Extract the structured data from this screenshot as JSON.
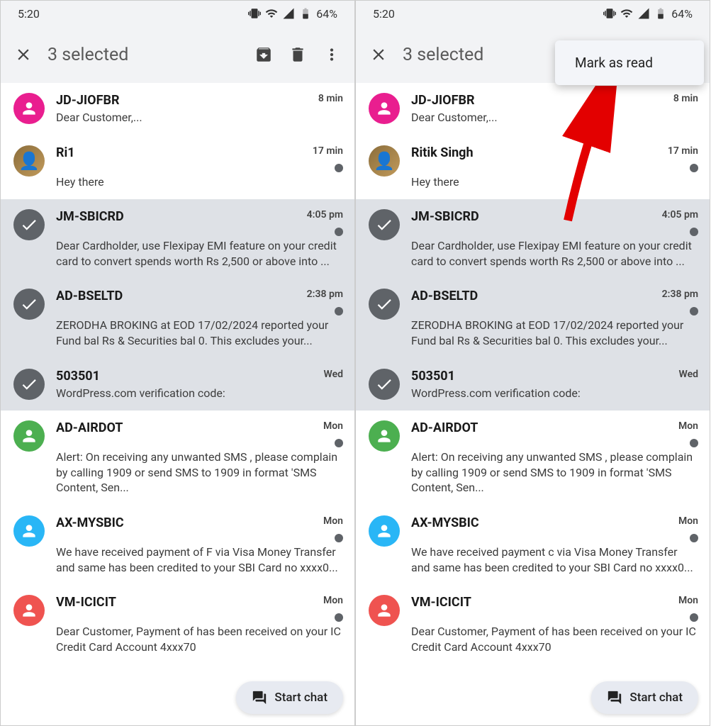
{
  "status": {
    "time": "5:20",
    "battery": "64%"
  },
  "header": {
    "title": "3 selected"
  },
  "menu": {
    "mark_read": "Mark as read"
  },
  "fab": {
    "label": "Start chat"
  },
  "convs": [
    {
      "sender": "JD-JIOFBR",
      "preview": "Dear Customer,...",
      "time": "8 min",
      "avatar": "pink",
      "selected": false,
      "dot": false
    },
    {
      "sender_a": "Ri1",
      "sender_b": "Ritik Singh",
      "preview": "Hey there",
      "time": "17 min",
      "avatar": "photo",
      "selected": false,
      "dot": true
    },
    {
      "sender": "JM-SBICRD",
      "preview": "Dear Cardholder, use Flexipay EMI feature on your credit card to convert spends worth Rs 2,500 or above into ...",
      "time": "4:05 pm",
      "avatar": "check",
      "selected": true,
      "dot": true
    },
    {
      "sender": "AD-BSELTD",
      "preview": "ZERODHA BROKING at EOD 17/02/2024 reported your Fund bal Rs & Securities bal 0. This excludes your...",
      "time": "2:38 pm",
      "avatar": "check",
      "selected": true,
      "dot": true
    },
    {
      "sender": "503501",
      "preview": "WordPress.com verification code:",
      "time": "Wed",
      "avatar": "check",
      "selected": true,
      "dot": false
    },
    {
      "sender": "AD-AIRDOT",
      "preview": "Alert: On receiving any unwanted SMS , please complain by calling 1909 or send SMS to 1909 in format 'SMS Content, Sen...",
      "time": "Mon",
      "avatar": "green",
      "selected": false,
      "dot": true
    },
    {
      "sender_a": "AX-MYSBIC",
      "sender_b": "AX-MYSBIC",
      "preview_a": "We have received payment of F via Visa Money Transfer and same has been credited to your SBI Card no xxxx0...",
      "preview_b": "We have received payment c via Visa Money Transfer and same has been credited to your SBI Card no xxxx0...",
      "time": "Mon",
      "avatar": "blue",
      "selected": false,
      "dot": true
    },
    {
      "sender": "VM-ICICIT",
      "preview": "Dear Customer, Payment of has been received on your IC Credit Card Account 4xxx70",
      "time": "Mon",
      "avatar": "red",
      "selected": false,
      "dot": true
    }
  ]
}
